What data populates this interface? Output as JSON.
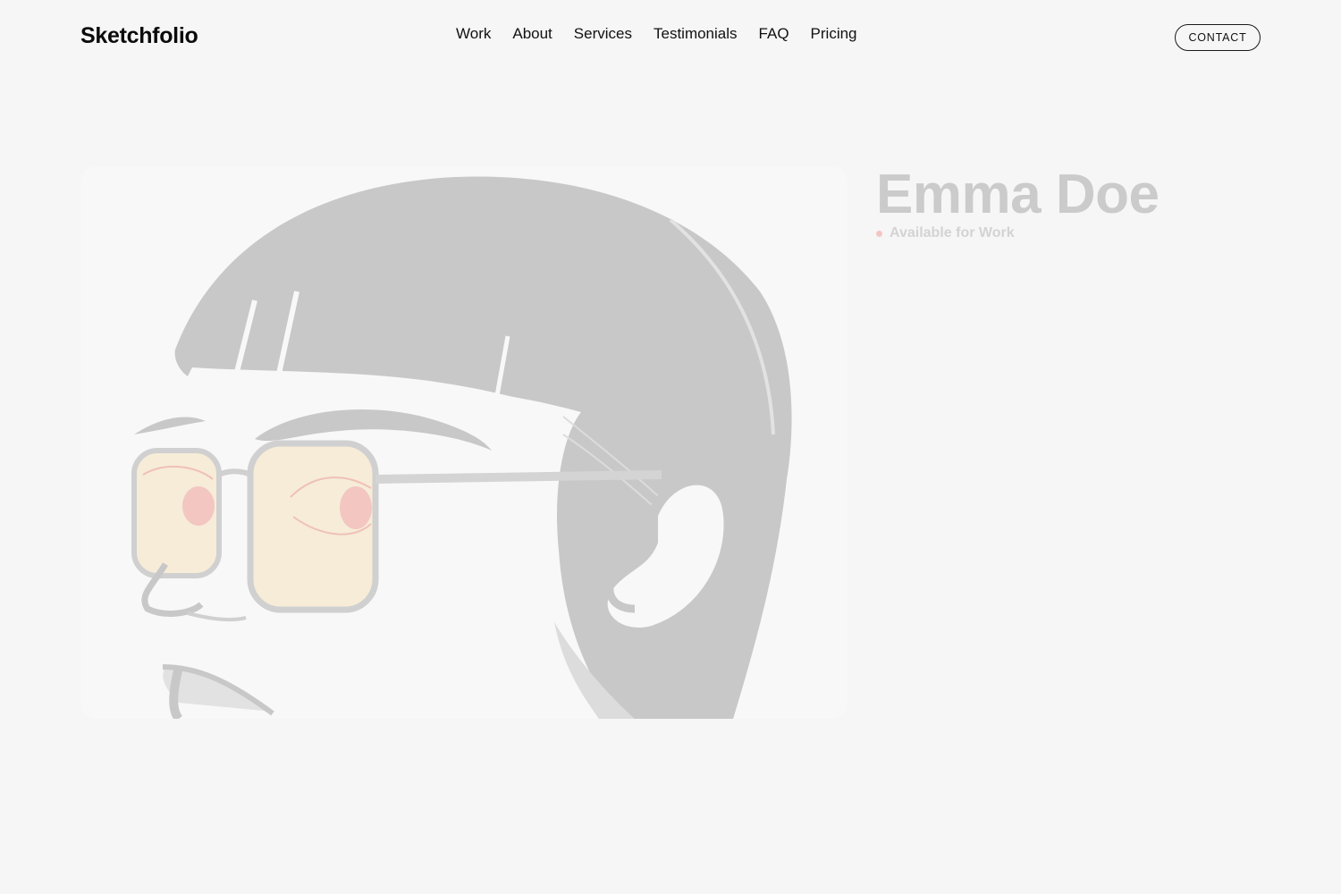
{
  "brand": {
    "name": "Sketchfolio"
  },
  "nav": {
    "items": [
      {
        "label": "Work"
      },
      {
        "label": "About"
      },
      {
        "label": "Services"
      },
      {
        "label": "Testimonials"
      },
      {
        "label": "FAQ"
      },
      {
        "label": "Pricing"
      }
    ],
    "contact_label": "CONTACT"
  },
  "hero": {
    "name": "Emma Doe",
    "status": "Available for Work",
    "status_color": "#f3c6c2",
    "illustration": "portrait-illustration-woman-with-glasses"
  },
  "colors": {
    "background": "#f6f6f6",
    "text": "#111111",
    "hero_text": "#cbcbcb",
    "lens_tint": "#f6ecd8",
    "hair": "#c8c8c8"
  }
}
